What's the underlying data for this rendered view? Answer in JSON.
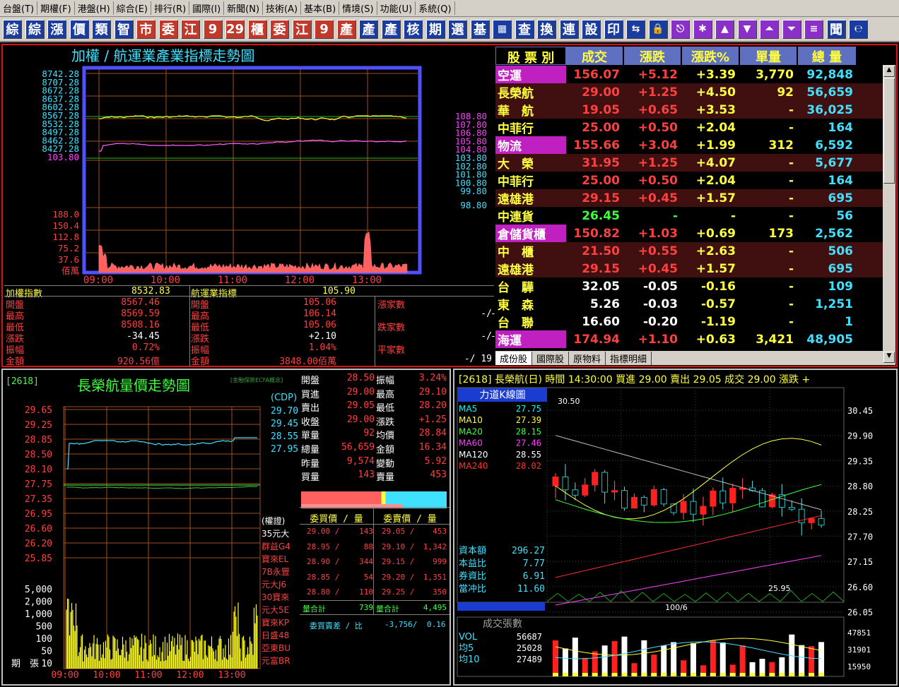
{
  "menu": [
    "台盤(T)",
    "期權(F)",
    "港盤(H)",
    "綜合(E)",
    "排行(R)",
    "國際(I)",
    "新聞(N)",
    "技術(A)",
    "基本(B)",
    "情境(S)",
    "功能(U)",
    "系統(Q)"
  ],
  "toolbar": [
    {
      "t": "綜",
      "c": "blue"
    },
    {
      "t": "綜",
      "c": "blue"
    },
    {
      "t": "漲",
      "c": "blue"
    },
    {
      "t": "價",
      "c": "blue"
    },
    {
      "t": "類",
      "c": "blue"
    },
    {
      "t": "智",
      "c": "blue"
    },
    {
      "t": "市",
      "c": "red"
    },
    {
      "t": "委",
      "c": "red"
    },
    {
      "t": "江",
      "c": "red"
    },
    {
      "t": "9",
      "c": "red"
    },
    {
      "t": "29",
      "c": "red"
    },
    {
      "t": "櫃",
      "c": "red"
    },
    {
      "t": "委",
      "c": "red"
    },
    {
      "t": "江",
      "c": "red"
    },
    {
      "t": "9",
      "c": "red"
    },
    {
      "t": "產",
      "c": "red"
    },
    {
      "t": "產",
      "c": "blue"
    },
    {
      "t": "產",
      "c": "blue"
    },
    {
      "t": "核",
      "c": "blue"
    },
    {
      "t": "期",
      "c": "blue"
    },
    {
      "t": "選",
      "c": "blue"
    },
    {
      "t": "基",
      "c": "blue"
    },
    {
      "t": "▦",
      "c": "sym"
    },
    {
      "t": "查",
      "c": "blue"
    },
    {
      "t": "換",
      "c": "blue"
    },
    {
      "t": "連",
      "c": "blue"
    },
    {
      "t": "設",
      "c": "blue"
    },
    {
      "t": "印",
      "c": "blue"
    },
    {
      "t": "⇆",
      "c": "sym"
    },
    {
      "t": "🔒",
      "c": "sym"
    },
    {
      "t": "⎋",
      "c": "pur"
    },
    {
      "t": "✱",
      "c": "pur"
    },
    {
      "t": "▲",
      "c": "pur"
    },
    {
      "t": "▼",
      "c": "pur"
    },
    {
      "t": "⏶",
      "c": "pur"
    },
    {
      "t": "⏷",
      "c": "pur"
    },
    {
      "t": "≡",
      "c": "pur"
    },
    {
      "t": "聞",
      "c": "blue"
    },
    {
      "t": "℮",
      "c": "sym"
    }
  ],
  "sector_chart": {
    "title": "加權 / 航運業產業指標走勢圖",
    "left_ticks": [
      "8742.28",
      "8707.28",
      "8672.28",
      "8637.28",
      "8602.28",
      "8567.28",
      "8532.28",
      "8497.28",
      "8462.28",
      "8427.28",
      "103.80"
    ],
    "right_ticks": [
      "108.80",
      "107.80",
      "106.80",
      "105.80",
      "104.80",
      "103.80",
      "102.80",
      "101.80",
      "100.80",
      "99.80",
      "98.80"
    ],
    "vol_ticks": [
      "188.0",
      "150.4",
      "112.8",
      "75.2",
      "37.6",
      "佰萬"
    ],
    "time_ticks": [
      "09:00",
      "10:00",
      "11:00",
      "12:00",
      "13:00"
    ]
  },
  "index_box": {
    "taiex_label": "加權指數",
    "taiex_value": "8532.83",
    "sector_label": "航運業指標",
    "sector_value": "105.90",
    "rows": [
      {
        "l": "開盤",
        "a": "8567.46",
        "m": "開盤",
        "b": "105.06"
      },
      {
        "l": "最高",
        "a": "8569.59",
        "m": "最高",
        "b": "106.14"
      },
      {
        "l": "最低",
        "a": "8508.16",
        "m": "最低",
        "b": "105.06"
      },
      {
        "l": "漲跌",
        "a": "-34.45",
        "m": "漲跌",
        "b": "+2.10"
      },
      {
        "l": "振幅",
        "a": "0.72%",
        "m": "振幅",
        "b": "1.04%"
      },
      {
        "l": "金額",
        "a": "920.56億",
        "m": "金額",
        "b": "3848.00佰萬"
      }
    ],
    "breadth": [
      {
        "l": "漲家數",
        "v": "-/"
      },
      {
        "l": "跌家數",
        "v": "-/"
      },
      {
        "l": "平家數",
        "v": "-/ 19"
      }
    ],
    "breadth_extra": [
      "-",
      "-"
    ]
  },
  "quote_header": [
    "股 票 別",
    "成交",
    "漲跌",
    "漲跌%",
    "單量",
    "總 量"
  ],
  "quotes": [
    {
      "n": "空運",
      "cat": true,
      "p": "156.07",
      "ch": "+5.12",
      "pct": "+3.39",
      "sv": "3,770",
      "tv": "92,848",
      "pc": "#ff4040",
      "cc": "#ff4040"
    },
    {
      "n": "長榮航",
      "cat": false,
      "p": "29.00",
      "ch": "+1.25",
      "pct": "+4.50",
      "sv": "92",
      "tv": "56,659",
      "pc": "#ff4040",
      "cc": "#ff4040",
      "ul": true
    },
    {
      "n": "華　航",
      "cat": false,
      "p": "19.05",
      "ch": "+0.65",
      "pct": "+3.53",
      "sv": "-",
      "tv": "36,025",
      "pc": "#ff4040",
      "cc": "#ff4040"
    },
    {
      "n": "中菲行",
      "cat": false,
      "p": "25.00",
      "ch": "+0.50",
      "pct": "+2.04",
      "sv": "-",
      "tv": "164",
      "pc": "#ff4040",
      "cc": "#ff4040"
    },
    {
      "n": "物流",
      "cat": true,
      "p": "155.66",
      "ch": "+3.04",
      "pct": "+1.99",
      "sv": "312",
      "tv": "6,592",
      "pc": "#ff4040",
      "cc": "#ff4040"
    },
    {
      "n": "大　榮",
      "cat": false,
      "p": "31.95",
      "ch": "+1.25",
      "pct": "+4.07",
      "sv": "-",
      "tv": "5,677",
      "pc": "#ff4040",
      "cc": "#ff4040"
    },
    {
      "n": "中菲行",
      "cat": false,
      "p": "25.00",
      "ch": "+0.50",
      "pct": "+2.04",
      "sv": "-",
      "tv": "164",
      "pc": "#ff4040",
      "cc": "#ff4040"
    },
    {
      "n": "遠雄港",
      "cat": false,
      "p": "29.15",
      "ch": "+0.45",
      "pct": "+1.57",
      "sv": "-",
      "tv": "695",
      "pc": "#ff4040",
      "cc": "#ff4040"
    },
    {
      "n": "中連貨",
      "cat": false,
      "p": "26.45",
      "ch": "-",
      "pct": "-",
      "sv": "-",
      "tv": "56",
      "pc": "#40ff40",
      "cc": "#40ff40"
    },
    {
      "n": "倉儲貨櫃",
      "cat": true,
      "p": "150.82",
      "ch": "+1.03",
      "pct": "+0.69",
      "sv": "173",
      "tv": "2,562",
      "pc": "#ff4040",
      "cc": "#ff4040"
    },
    {
      "n": "中　櫃",
      "cat": false,
      "p": "21.50",
      "ch": "+0.55",
      "pct": "+2.63",
      "sv": "-",
      "tv": "506",
      "pc": "#ff4040",
      "cc": "#ff4040"
    },
    {
      "n": "遠雄港",
      "cat": false,
      "p": "29.15",
      "ch": "+0.45",
      "pct": "+1.57",
      "sv": "-",
      "tv": "695",
      "pc": "#ff4040",
      "cc": "#ff4040"
    },
    {
      "n": "台　驊",
      "cat": false,
      "p": "32.05",
      "ch": "-0.05",
      "pct": "-0.16",
      "sv": "-",
      "tv": "109",
      "pc": "#ffffff",
      "cc": "#ffffff"
    },
    {
      "n": "東　森",
      "cat": false,
      "p": "5.26",
      "ch": "-0.03",
      "pct": "-0.57",
      "sv": "-",
      "tv": "1,251",
      "pc": "#ffffff",
      "cc": "#ffffff"
    },
    {
      "n": "台　聯",
      "cat": false,
      "p": "16.60",
      "ch": "-0.20",
      "pct": "-1.19",
      "sv": "-",
      "tv": "1",
      "pc": "#ffffff",
      "cc": "#ffffff"
    },
    {
      "n": "海運",
      "cat": true,
      "p": "174.94",
      "ch": "+1.10",
      "pct": "+0.63",
      "sv": "3,421",
      "tv": "48,905",
      "pc": "#ff4040",
      "cc": "#ff4040"
    }
  ],
  "quote_tabs": [
    "成份股",
    "國際股",
    "原物料",
    "指標明細"
  ],
  "intraday": {
    "code": "[2618]",
    "title": "長榮航量價走勢圖",
    "note": "[金融保險ECFA概念]",
    "price_ticks": [
      "29.65",
      "29.25",
      "28.85",
      "28.50",
      "28.10",
      "27.75",
      "27.35",
      "26.95",
      "26.60",
      "26.20",
      "25.85"
    ],
    "cdp_label": "(CDP)",
    "cdp": [
      "29.70",
      "29.45",
      "28.55",
      "27.95"
    ],
    "vol_ticks": [
      "5,000",
      "2,000",
      "1,000",
      "500",
      "100",
      "50",
      "10"
    ],
    "vol_axis_label": "期　張",
    "time_ticks": [
      "09:00",
      "10:00",
      "11:00",
      "12:00",
      "13:00"
    ],
    "brokers_title": "(權證)",
    "brokers": [
      "35元大",
      "群益G4",
      "寶來EL",
      "7B永豐",
      "元大J6",
      "30寶來",
      "元大5E",
      "寶來KP",
      "日盛48",
      "亞東BU",
      "元富BR"
    ]
  },
  "detail": {
    "stats": [
      {
        "l": "開盤",
        "v": "28.50",
        "l2": "振幅",
        "v2": "3.24%"
      },
      {
        "l": "買進",
        "v": "29.00",
        "l2": "最高",
        "v2": "29.10"
      },
      {
        "l": "賣出",
        "v": "29.05",
        "l2": "最低",
        "v2": "28.20"
      },
      {
        "l": "收盤",
        "v": "29.00",
        "l2": "漲跌",
        "v2": "+1.25"
      },
      {
        "l": "單量",
        "v": "92",
        "l2": "均價",
        "v2": "28.84"
      },
      {
        "l": "總量",
        "v": "56,659",
        "l2": "金額",
        "v2": "16.34"
      },
      {
        "l": "昨量",
        "v": "9,574",
        "l2": "變動",
        "v2": "5.92"
      },
      {
        "l": "買量",
        "v": "143",
        "l2": "賣量",
        "v2": "453"
      }
    ],
    "book_head": [
      "委買價 / 量",
      "委賣價 / 量"
    ],
    "book": [
      {
        "bp": "29.00",
        "bq": "143",
        "ap": "29.05",
        "aq": "453"
      },
      {
        "bp": "28.95",
        "bq": "88",
        "ap": "29.10",
        "aq": "1,342"
      },
      {
        "bp": "28.90",
        "bq": "344",
        "ap": "29.15",
        "aq": "999"
      },
      {
        "bp": "28.85",
        "bq": "54",
        "ap": "29.20",
        "aq": "1,351"
      },
      {
        "bp": "28.80",
        "bq": "110",
        "ap": "29.25",
        "aq": "350"
      }
    ],
    "bid_total_label": "量合計",
    "bid_total": "739",
    "ask_total_label": "量合計",
    "ask_total": "4,495",
    "diff_label": "委買賣差 / 比",
    "diff": "-3,756/",
    "ratio": "0.16"
  },
  "kline": {
    "header": "[2618] 長榮航(日)  時間 14:30:00    買進 29.00   賣出 29.05   成交 29.00   漲跌 +",
    "title": "力道K線圖",
    "ma": [
      {
        "n": "MA5",
        "v": "27.75",
        "c": "#00ffff"
      },
      {
        "n": "MA10",
        "v": "27.39",
        "c": "#ffff40"
      },
      {
        "n": "MA20",
        "v": "28.15",
        "c": "#40ff40"
      },
      {
        "n": "MA60",
        "v": "27.46",
        "c": "#ff40ff"
      },
      {
        "n": "MA120",
        "v": "28.55",
        "c": "#ffffff"
      },
      {
        "n": "MA240",
        "v": "28.02",
        "c": "#ff3030"
      }
    ],
    "fund": [
      {
        "n": "資本額",
        "v": "296.27"
      },
      {
        "n": "本益比",
        "v": "7.77"
      },
      {
        "n": "券資比",
        "v": "6.91"
      },
      {
        "n": "當冲比",
        "v": "11.60"
      }
    ],
    "price_ticks": [
      "30.45",
      "29.90",
      "29.35",
      "28.80",
      "28.25",
      "27.70",
      "27.15",
      "26.60",
      "26.05"
    ],
    "hi_label": "30.50",
    "lo_label": "25.95",
    "date_label": "100/6",
    "vol_title": "成交張數",
    "vol": [
      {
        "n": "VOL",
        "v": "56687"
      },
      {
        "n": "均5",
        "v": "25028"
      },
      {
        "n": "均10",
        "v": "27489"
      }
    ],
    "vol_ticks": [
      "47851",
      "31901",
      "15950"
    ]
  }
}
